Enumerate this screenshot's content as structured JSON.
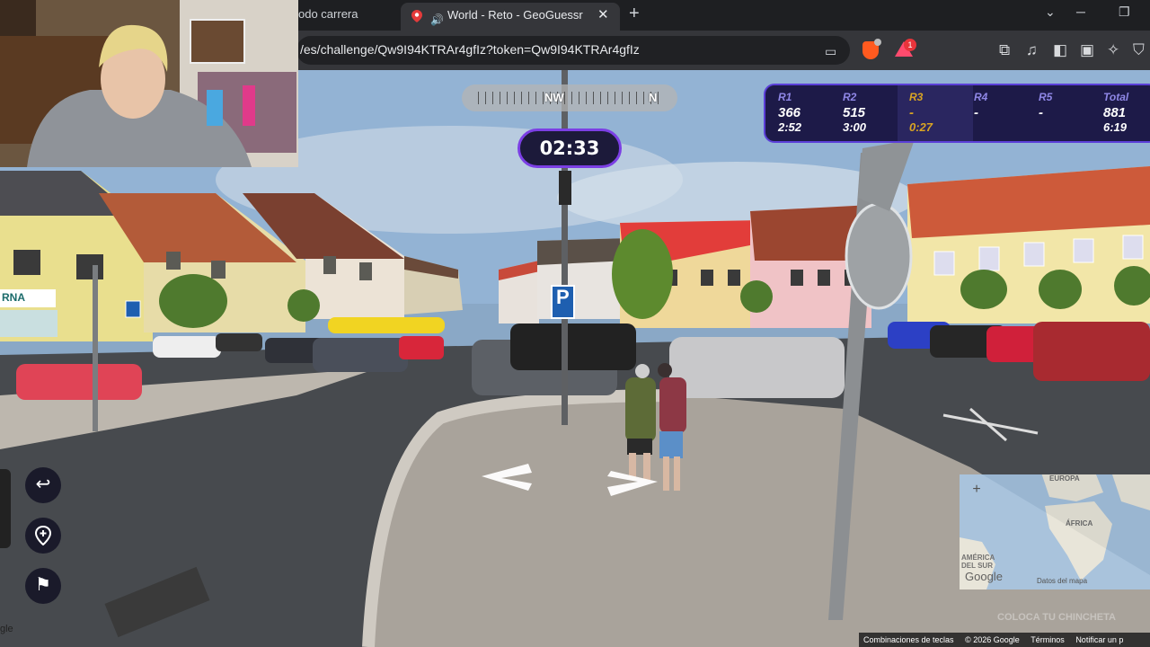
{
  "browser": {
    "prev_tab_label": "odo carrera",
    "active_tab_title": "World - Reto - GeoGuessr",
    "url": "/es/challenge/Qw9I94KTRAr4gfIz?token=Qw9I94KTRAr4gfIz",
    "rewards_badge": "1",
    "icons": [
      "cast-icon",
      "brave-shields-icon",
      "brave-rewards-icon",
      "extensions-icon",
      "media-icon",
      "sidebar-icon",
      "wallet-icon",
      "leo-ai-icon",
      "vpn-icon"
    ]
  },
  "game": {
    "compass": {
      "left_label": "NW",
      "right_label": "N"
    },
    "timer": "02:33",
    "rounds": [
      {
        "label": "R1",
        "score": "366",
        "time": "2:52",
        "active": false
      },
      {
        "label": "R2",
        "score": "515",
        "time": "3:00",
        "active": false
      },
      {
        "label": "R3",
        "score": "-",
        "time": "0:27",
        "active": true
      },
      {
        "label": "R4",
        "score": "-",
        "time": "",
        "active": false
      },
      {
        "label": "R5",
        "score": "-",
        "time": "",
        "active": false
      },
      {
        "label": "Total",
        "score": "881",
        "time": "6:19",
        "active": false
      }
    ],
    "side_controls": [
      "back-to-start",
      "set-checkpoint",
      "return-to-checkpoint"
    ],
    "street_sign": "P",
    "store_sign": "RNA",
    "guess_button": "COLOCA TU CHINCHETA",
    "minimap": {
      "zoom_in": "+",
      "continents": [
        "EUROPA",
        "ÁFRICA",
        "AMÉRICA DEL SUR"
      ],
      "google": "Google",
      "datos": "Datos del mapa"
    }
  },
  "footer": {
    "shortcuts": "Combinaciones de teclas",
    "copyright": "© 2026 Google",
    "terms": "Términos",
    "report": "Notificar un p"
  },
  "corner_text": "gle",
  "colors": {
    "accent_purple": "#7b3fe4",
    "scorebar_bg": "#1d1a48",
    "active_round": "#d9a423"
  }
}
